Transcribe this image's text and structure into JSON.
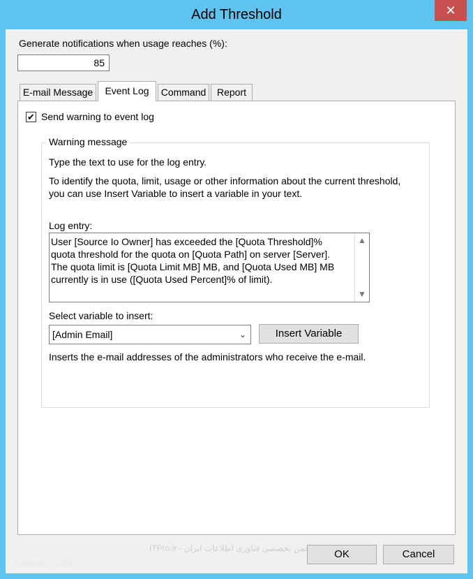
{
  "window": {
    "title": "Add Threshold",
    "close_glyph": "✕"
  },
  "threshold": {
    "label": "Generate notifications when usage reaches (%):",
    "value": "85"
  },
  "tabs": [
    {
      "label": "E-mail Message"
    },
    {
      "label": "Event Log"
    },
    {
      "label": "Command"
    },
    {
      "label": "Report"
    }
  ],
  "event_log": {
    "checkbox_label": "Send warning to event log",
    "checked_glyph": "✔",
    "group_title": "Warning message",
    "intro_text": "Type the text to use for the log entry.",
    "help_text_line1": "To identify the quota, limit, usage or other information about the current threshold,",
    "help_text_line2": "you can use Insert Variable to insert a variable in your text.",
    "log_entry_label": "Log entry:",
    "log_entry_text": "User [Source Io Owner] has exceeded the [Quota Threshold]%\nquota threshold for the quota on [Quota Path] on server [Server].\nThe quota limit is [Quota Limit MB] MB, and [Quota Used MB] MB\ncurrently is in use ([Quota Used Percent]% of limit).",
    "scroll_up_glyph": "▲",
    "scroll_down_glyph": "▼",
    "variable_label": "Select variable to insert:",
    "variable_selected": "[Admin Email]",
    "chevron_glyph": "⌄",
    "insert_button": "Insert Variable",
    "variable_description": "Inserts the e-mail addresses of the administrators who receive the e-mail."
  },
  "footer": {
    "ok_label": "OK",
    "cancel_label": "Cancel",
    "watermark_left": "TOSINSO.COM",
    "watermark_center": "ITPro.ir - انجمن تخصصی فناوری اطلاعات ایران"
  },
  "colors": {
    "titlebar": "#5fc3ef",
    "close_button": "#c7504f",
    "client_bg": "#f0f0f0"
  }
}
